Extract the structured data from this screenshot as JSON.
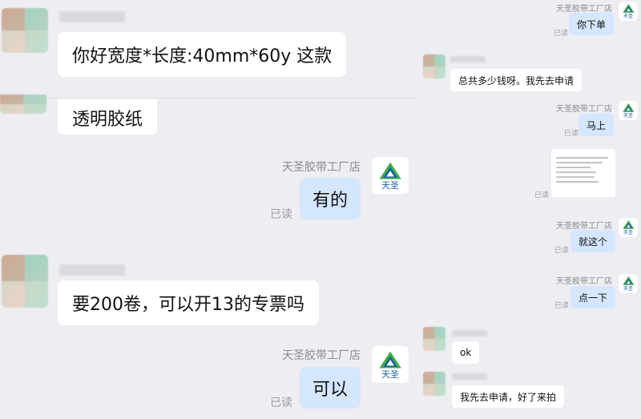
{
  "left": {
    "messages": [
      {
        "text": "你好宽度*长度:40mm*60y 这款"
      },
      {
        "text": "透明胶纸"
      },
      {
        "shop": "天圣胶带工厂店",
        "text": "有的",
        "read": "已读"
      },
      {
        "text": "要200卷，可以开13的专票吗"
      },
      {
        "shop": "天圣胶带工厂店",
        "text": "可以",
        "read": "已读"
      }
    ]
  },
  "right": {
    "messages": [
      {
        "shop": "天圣胶带工厂店",
        "text": "你下单",
        "read": "已读"
      },
      {
        "text": "总共多少钱呀。我先去申请"
      },
      {
        "shop": "天圣胶带工厂店",
        "text": "马上",
        "read": "已读"
      },
      {
        "read": "已读"
      },
      {
        "shop": "天圣胶带工厂店",
        "text": "就这个",
        "read": "已读"
      },
      {
        "shop": "天圣胶带工厂店",
        "text": "点一下",
        "read": "已读"
      },
      {
        "text": "ok"
      },
      {
        "text": "我先去申请，好了来拍"
      }
    ]
  },
  "logo": {
    "text": "天圣",
    "color": "#1c5f9d",
    "accent": "#3fae49"
  },
  "colors": {
    "my_bubble": "#d5e6ff",
    "their_bubble": "#ffffff",
    "background": "#ededf2"
  }
}
